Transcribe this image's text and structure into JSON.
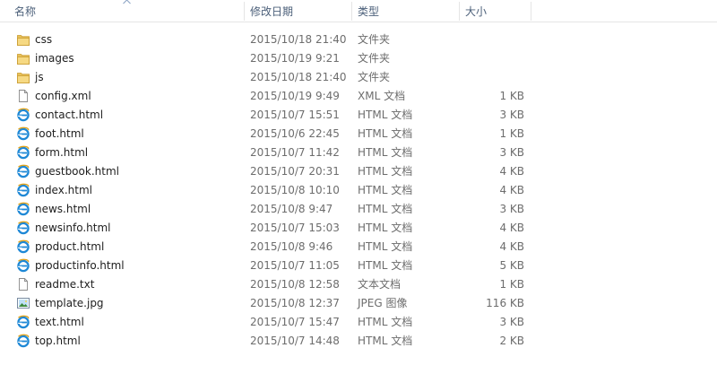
{
  "header": {
    "name": "名称",
    "date": "修改日期",
    "type": "类型",
    "size": "大小"
  },
  "files": [
    {
      "icon": "folder-icon",
      "name": "css",
      "date": "2015/10/18 21:40",
      "type": "文件夹",
      "size": ""
    },
    {
      "icon": "folder-icon",
      "name": "images",
      "date": "2015/10/19 9:21",
      "type": "文件夹",
      "size": ""
    },
    {
      "icon": "folder-icon",
      "name": "js",
      "date": "2015/10/18 21:40",
      "type": "文件夹",
      "size": ""
    },
    {
      "icon": "document-icon",
      "name": "config.xml",
      "date": "2015/10/19 9:49",
      "type": "XML 文档",
      "size": "1 KB"
    },
    {
      "icon": "ie-html-icon",
      "name": "contact.html",
      "date": "2015/10/7 15:51",
      "type": "HTML 文档",
      "size": "3 KB"
    },
    {
      "icon": "ie-html-icon",
      "name": "foot.html",
      "date": "2015/10/6 22:45",
      "type": "HTML 文档",
      "size": "1 KB"
    },
    {
      "icon": "ie-html-icon",
      "name": "form.html",
      "date": "2015/10/7 11:42",
      "type": "HTML 文档",
      "size": "3 KB"
    },
    {
      "icon": "ie-html-icon",
      "name": "guestbook.html",
      "date": "2015/10/7 20:31",
      "type": "HTML 文档",
      "size": "4 KB"
    },
    {
      "icon": "ie-html-icon",
      "name": "index.html",
      "date": "2015/10/8 10:10",
      "type": "HTML 文档",
      "size": "4 KB"
    },
    {
      "icon": "ie-html-icon",
      "name": "news.html",
      "date": "2015/10/8 9:47",
      "type": "HTML 文档",
      "size": "3 KB"
    },
    {
      "icon": "ie-html-icon",
      "name": "newsinfo.html",
      "date": "2015/10/7 15:03",
      "type": "HTML 文档",
      "size": "4 KB"
    },
    {
      "icon": "ie-html-icon",
      "name": "product.html",
      "date": "2015/10/8 9:46",
      "type": "HTML 文档",
      "size": "4 KB"
    },
    {
      "icon": "ie-html-icon",
      "name": "productinfo.html",
      "date": "2015/10/7 11:05",
      "type": "HTML 文档",
      "size": "5 KB"
    },
    {
      "icon": "document-icon",
      "name": "readme.txt",
      "date": "2015/10/8 12:58",
      "type": "文本文档",
      "size": "1 KB"
    },
    {
      "icon": "image-icon",
      "name": "template.jpg",
      "date": "2015/10/8 12:37",
      "type": "JPEG 图像",
      "size": "116 KB"
    },
    {
      "icon": "ie-html-icon",
      "name": "text.html",
      "date": "2015/10/7 15:47",
      "type": "HTML 文档",
      "size": "3 KB"
    },
    {
      "icon": "ie-html-icon",
      "name": "top.html",
      "date": "2015/10/7 14:48",
      "type": "HTML 文档",
      "size": "2 KB"
    }
  ],
  "colors": {
    "header_text": "#4c607a",
    "name_text": "#1e1e1e",
    "detail_text": "#6d6d6d",
    "folder": "#e8c15a",
    "ie_blue": "#1e88d6"
  }
}
